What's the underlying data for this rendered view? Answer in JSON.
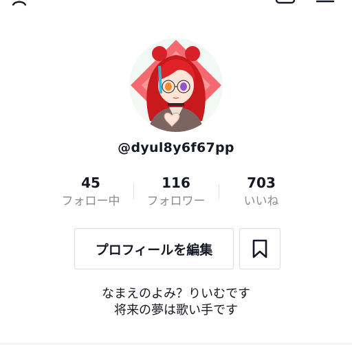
{
  "header": {
    "title": "",
    "left_icon": "add-user-icon",
    "right_icons": [
      "footprint-icon",
      "menu-icon"
    ]
  },
  "profile": {
    "avatar_icon": "anime-girl-avatar",
    "username": "@dyul8y6f67pp"
  },
  "stats": [
    {
      "value": "45",
      "label": "フォロー中"
    },
    {
      "value": "116",
      "label": "フォロワー"
    },
    {
      "value": "703",
      "label": "いいね"
    }
  ],
  "actions": {
    "edit_profile_label": "プロフィールを編集",
    "bookmark_icon": "bookmark-icon"
  },
  "bio": {
    "line1": "なまえのよみ？りいむです",
    "line2": "将来の夢は歌い手です"
  },
  "colors": {
    "text": "#161823",
    "secondary_text": "#8a8b91",
    "border": "#dcdcde"
  }
}
